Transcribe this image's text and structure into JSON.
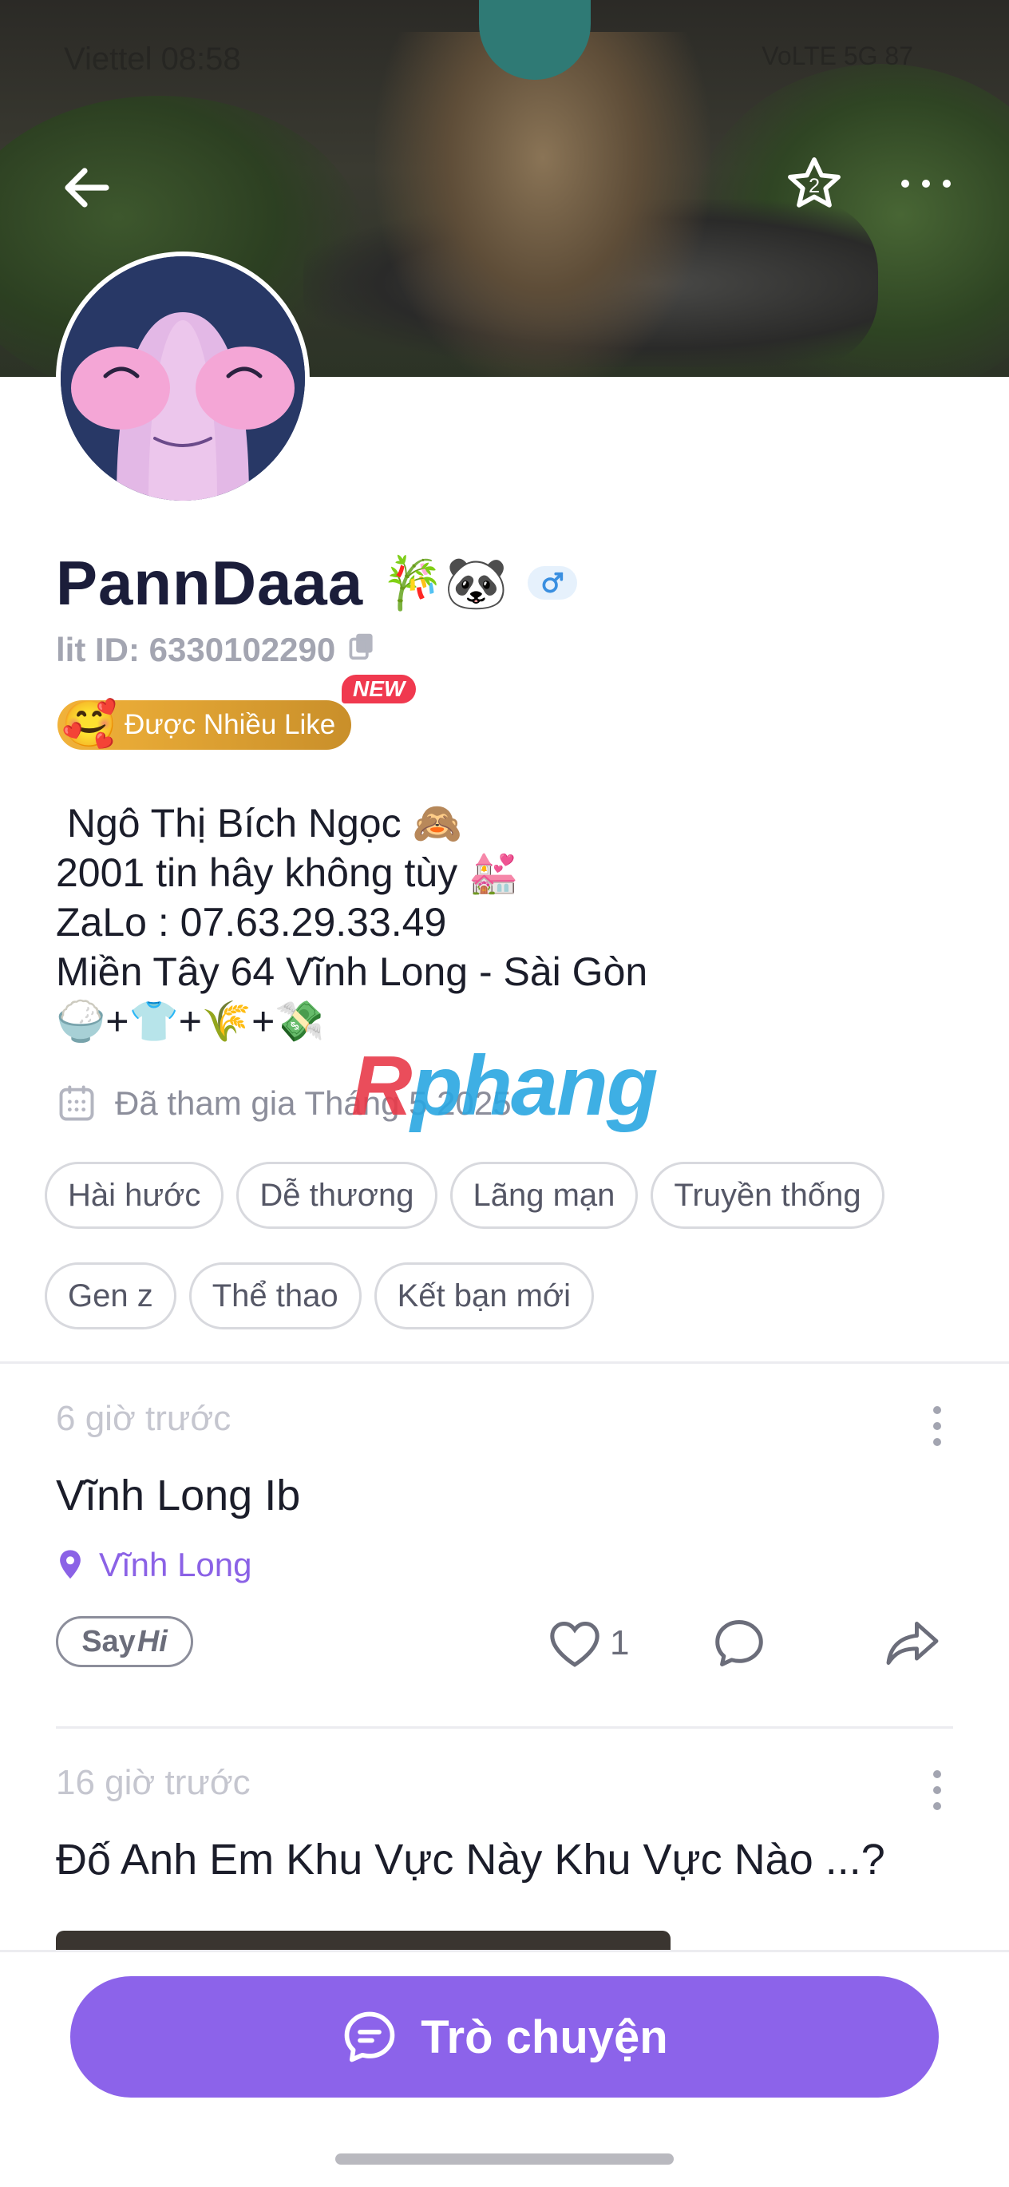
{
  "status_bar": {
    "carrier_time": "Viettel 08:58",
    "right": "VoLTE 5G 87"
  },
  "header": {
    "back_icon": "arrow-left-icon",
    "favorite_icon": "star-icon",
    "favorite_count": "2",
    "more_icon": "more-horizontal-icon"
  },
  "profile": {
    "name": "PannDaaa",
    "name_emoji": "🎋🐼",
    "gender_symbol": "♂",
    "lit_id": "lit ID: 6330102290",
    "badge_label": "Được Nhiều Like",
    "badge_emoji": "🥰",
    "badge_new": "NEW",
    "bio_lines": [
      " Ngô Thị Bích Ngọc 🙈",
      "2001 tin hây không tùy 💒",
      "ZaLo : 07.63.29.33.49",
      "Miền Tây 64 Vĩnh Long - Sài Gòn",
      "🍚+👕+🌾+💸"
    ],
    "joined": "Đã tham gia Tháng 5 2025",
    "tags": [
      "Hài hước",
      "Dễ thương",
      "Lãng mạn",
      "Truyền thống",
      "Gen z",
      "Thể thao",
      "Kết bạn mới"
    ]
  },
  "watermark": {
    "r": "R",
    "rest": "phang"
  },
  "posts": [
    {
      "time": "6 giờ trước",
      "title": "Vĩnh Long Ib",
      "location": "Vĩnh Long",
      "sayhi_a": "Say",
      "sayhi_b": "Hi",
      "likes": "1"
    },
    {
      "time": "16 giờ trước",
      "title": "Đố Anh Em Khu Vực Này Khu Vực Nào ...?"
    }
  ],
  "bottom": {
    "chat_label": "Trò chuyện"
  },
  "colors": {
    "accent": "#8c63ea",
    "badge_gold": "#f1b23a",
    "new_red": "#f0394f"
  }
}
